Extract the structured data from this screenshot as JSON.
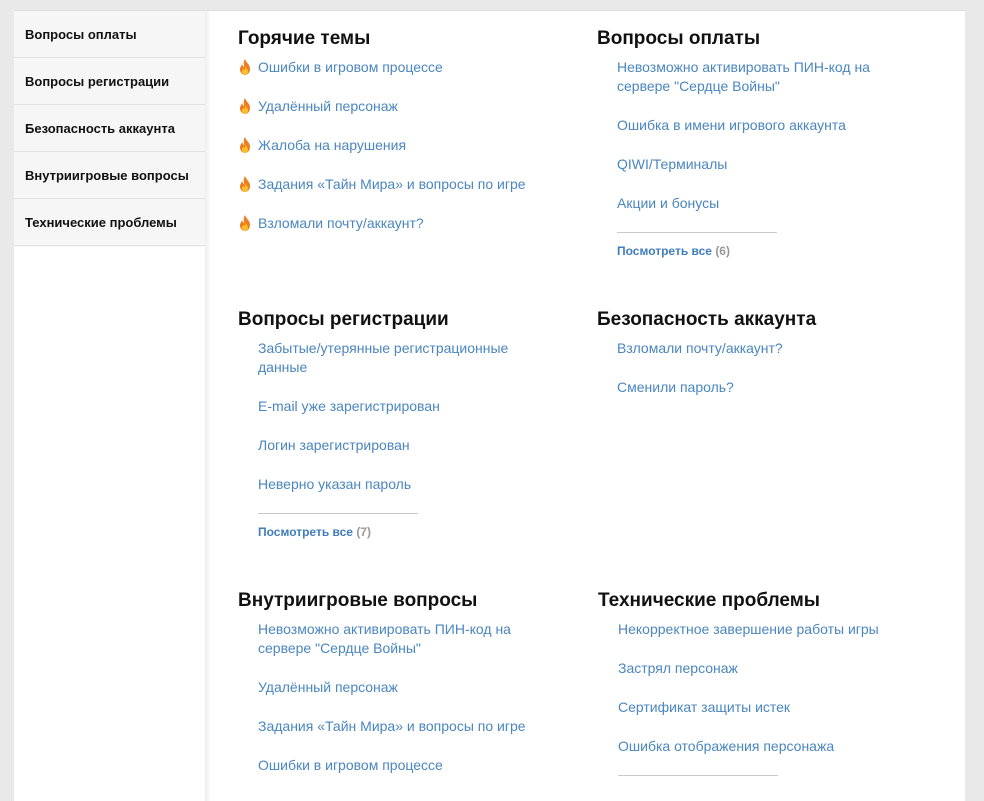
{
  "sidebar": {
    "items": [
      {
        "label": "Вопросы оплаты"
      },
      {
        "label": "Вопросы регистрации"
      },
      {
        "label": "Безопасность аккаунта"
      },
      {
        "label": "Внутриигровые вопросы"
      },
      {
        "label": "Технические проблемы"
      }
    ]
  },
  "hot": {
    "title": "Горячие темы",
    "links": [
      "Ошибки в игровом процессе",
      "Удалённый персонаж",
      "Жалоба на нарушения",
      "Задания «Тайн Мира» и вопросы по игре",
      "Взломали почту/аккаунт?"
    ],
    "icon": "fire-icon"
  },
  "payment": {
    "title": "Вопросы оплаты",
    "links": [
      "Невозможно активировать ПИН-код на сервере \"Сердце Войны\"",
      "Ошибка в имени игрового аккаунта",
      "QIWI/Терминалы",
      "Акции и бонусы"
    ],
    "view_all": "Посмотреть все",
    "count": "(6)"
  },
  "registration": {
    "title": "Вопросы регистрации",
    "links": [
      "Забытые/утерянные регистрационные данные",
      "E-mail уже зарегистрирован",
      "Логин зарегистрирован",
      "Неверно указан пароль"
    ],
    "view_all": "Посмотреть все",
    "count": "(7)"
  },
  "security": {
    "title": "Безопасность аккаунта",
    "links": [
      "Взломали почту/аккаунт?",
      "Сменили пароль?"
    ]
  },
  "ingame": {
    "title": "Внутриигровые вопросы",
    "links": [
      "Невозможно активировать ПИН-код на сервере \"Сердце Войны\"",
      "Удалённый персонаж",
      "Задания «Тайн Мира» и вопросы по игре",
      "Ошибки в игровом процессе"
    ]
  },
  "technical": {
    "title": "Технические проблемы",
    "links": [
      "Некорректное завершение работы игры",
      "Застрял персонаж",
      "Сертификат защиты истек",
      "Ошибка отображения персонажа"
    ]
  },
  "colors": {
    "link": "#4a86bf",
    "heading": "#111111",
    "sidebar_bg": "#f6f6f6",
    "page_bg": "#e9e9e9",
    "count": "#999999"
  }
}
